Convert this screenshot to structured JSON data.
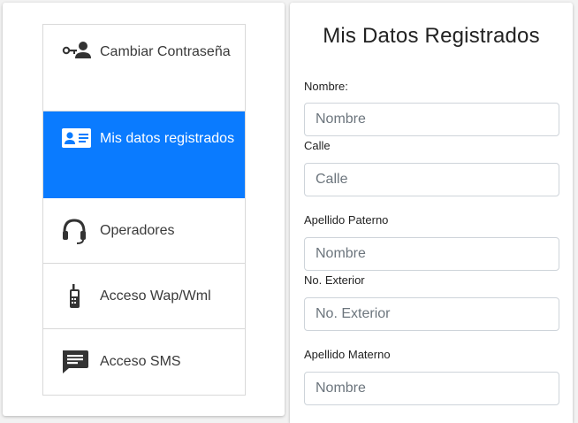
{
  "menu": {
    "items": [
      {
        "label": "Cambiar Contraseña",
        "icon": "key-user-icon",
        "active": false
      },
      {
        "label": "Mis datos registrados",
        "icon": "id-card-icon",
        "active": true
      },
      {
        "label": "Operadores",
        "icon": "headset-icon",
        "active": false
      },
      {
        "label": "Acceso Wap/Wml",
        "icon": "cell-phone-icon",
        "active": false
      },
      {
        "label": "Acceso SMS",
        "icon": "message-icon",
        "active": false
      }
    ]
  },
  "form": {
    "title": "Mis Datos Registrados",
    "fields": [
      {
        "label": "Nombre:",
        "placeholder": "Nombre"
      },
      {
        "label": "Calle",
        "placeholder": "Calle"
      },
      {
        "label": "Apellido Paterno",
        "placeholder": "Nombre"
      },
      {
        "label": "No. Exterior",
        "placeholder": "No. Exterior"
      },
      {
        "label": "Apellido Materno",
        "placeholder": "Nombre"
      }
    ]
  },
  "colors": {
    "active": "#0a7bff",
    "icon": "#333333"
  }
}
